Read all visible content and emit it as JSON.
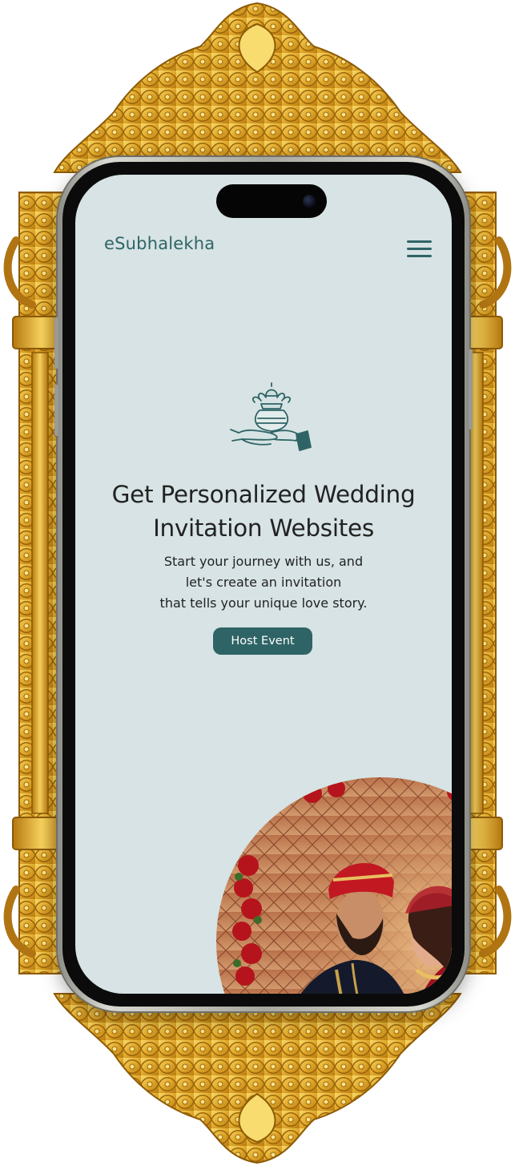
{
  "header": {
    "brand": "eSubhalekha",
    "menu_icon": "hamburger-menu-icon"
  },
  "hero": {
    "emblem_icon": "kalash-hands-icon",
    "headline_line1": "Get Personalized Wedding",
    "headline_line2": "Invitation Websites",
    "subtext_line1": "Start your journey with us, and",
    "subtext_line2": "let's create an invitation",
    "subtext_line3": "that tells your unique love story.",
    "cta_label": "Host Event"
  },
  "colors": {
    "brand_teal": "#2f6466",
    "screen_bg": "#d7e3e4",
    "frame_gold": "#d9a52a"
  }
}
